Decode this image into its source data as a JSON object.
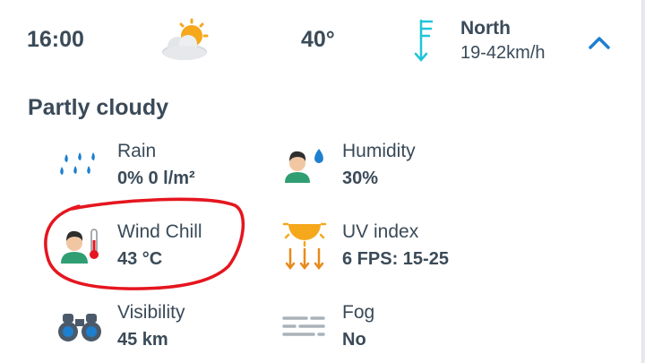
{
  "header": {
    "time": "16:00",
    "condition_icon": "partly-cloudy-icon",
    "temperature": "40°",
    "wind_icon": "wind-arrow-icon",
    "wind_direction": "North",
    "wind_speed": "19-42km/h",
    "toggle_icon": "chevron-up-icon"
  },
  "summary": "Partly cloudy",
  "details": [
    {
      "icon": "rain-icon",
      "label": "Rain",
      "value": "0% 0 l/m²"
    },
    {
      "icon": "humidity-icon",
      "label": "Humidity",
      "value": "30%"
    },
    {
      "icon": "wind-chill-icon",
      "label": "Wind Chill",
      "value": "43 °C"
    },
    {
      "icon": "uv-sun-icon",
      "label": "UV index",
      "value": "6 FPS: 15-25"
    },
    {
      "icon": "binoculars-icon",
      "label": "Visibility",
      "value": "45 km"
    },
    {
      "icon": "fog-icon",
      "label": "Fog",
      "value": "No"
    }
  ],
  "colors": {
    "text": "#3a4a58",
    "accent_blue": "#1e7fcf",
    "wind_cyan": "#1fc4d9",
    "sun_orange": "#f5a81c",
    "annotation_red": "#e5151f"
  }
}
